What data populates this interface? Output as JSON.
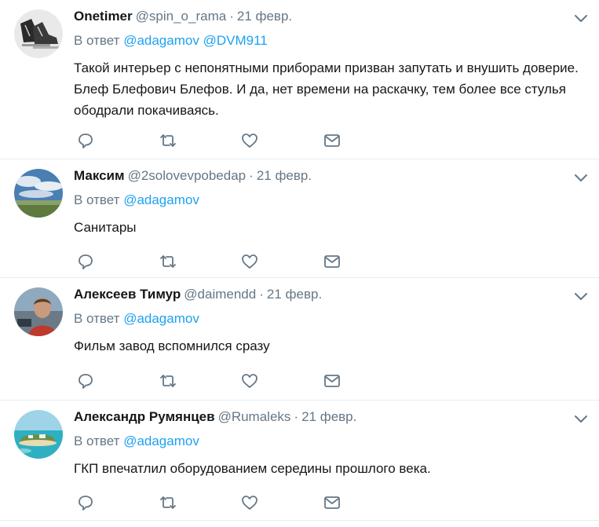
{
  "colors": {
    "link": "#1da1f2",
    "muted": "#657786",
    "text": "#14171a",
    "divider": "#e6ecf0"
  },
  "tweets": [
    {
      "name": "Onetimer",
      "handle": "@spin_o_rama",
      "sep": "·",
      "date": "21 февр.",
      "reply_prefix": "В ответ",
      "mentions": [
        "@adagamov",
        "@DVM911"
      ],
      "text": "Такой интерьер с непонятными приборами призван запутать и внушить доверие. Блеф Блефович Блефов. И да, нет времени на раскачку, тем более все стулья ободрали покачиваясь.",
      "avatar_icon": "skates-avatar"
    },
    {
      "name": "Максим",
      "handle": "@2solovevpobedap",
      "sep": "·",
      "date": "21 февр.",
      "reply_prefix": "В ответ",
      "mentions": [
        "@adagamov"
      ],
      "text": "Санитары",
      "avatar_icon": "sky-avatar"
    },
    {
      "name": "Алексеев Тимур",
      "handle": "@daimendd",
      "sep": "·",
      "date": "21 февр.",
      "reply_prefix": "В ответ",
      "mentions": [
        "@adagamov"
      ],
      "text": "Фильм завод вспомнился сразу",
      "avatar_icon": "person-avatar"
    },
    {
      "name": "Александр Румянцев",
      "handle": "@Rumaleks",
      "sep": "·",
      "date": "21 февр.",
      "reply_prefix": "В ответ",
      "mentions": [
        "@adagamov"
      ],
      "text": "ГКП впечатлил оборудованием середины прошлого века.",
      "avatar_icon": "island-avatar"
    }
  ]
}
